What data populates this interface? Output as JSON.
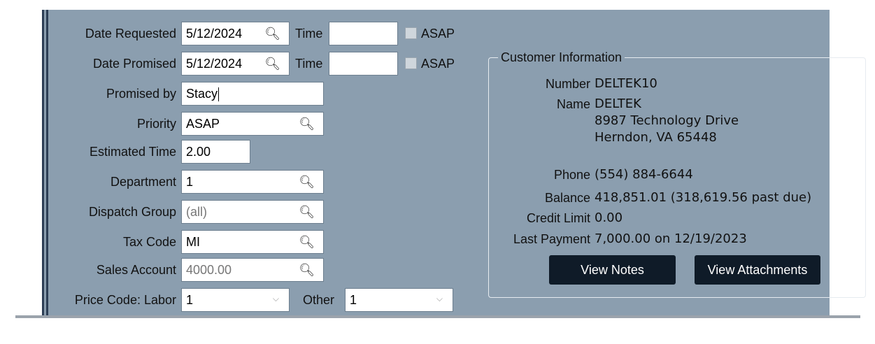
{
  "form": {
    "date_requested": {
      "label": "Date Requested",
      "value": "5/12/2024",
      "time_label": "Time",
      "time_value": "",
      "asap_label": "ASAP"
    },
    "date_promised": {
      "label": "Date Promised",
      "value": "5/12/2024",
      "time_label": "Time",
      "time_value": "",
      "asap_label": "ASAP"
    },
    "promised_by": {
      "label": "Promised by",
      "value": "Stacy"
    },
    "priority": {
      "label": "Priority",
      "value": "ASAP"
    },
    "estimated_time": {
      "label": "Estimated Time",
      "value": "2.00"
    },
    "department": {
      "label": "Department",
      "value": "1"
    },
    "dispatch_group": {
      "label": "Dispatch Group",
      "value": "(all)"
    },
    "tax_code": {
      "label": "Tax Code",
      "value": "MI"
    },
    "sales_account": {
      "label": "Sales Account",
      "value": "4000.00"
    },
    "price_code": {
      "label": "Price Code: Labor",
      "labor_value": "1",
      "other_label": "Other",
      "other_value": "1"
    }
  },
  "customer": {
    "title": "Customer Information",
    "number_label": "Number",
    "number": "DELTEK10",
    "name_label": "Name",
    "name": "DELTEK",
    "address1": "8987 Technology Drive",
    "address2": "Herndon, VA 65448",
    "phone_label": "Phone",
    "phone": "(554) 884-6644",
    "balance_label": "Balance",
    "balance": "418,851.01  (318,619.56 past due)",
    "credit_limit_label": "Credit Limit",
    "credit_limit": "0.00",
    "last_payment_label": "Last Payment",
    "last_payment": "7,000.00 on 12/19/2023",
    "view_notes": "View Notes",
    "view_attachments": "View Attachments"
  },
  "colors": {
    "panel": "#8b9eaf",
    "button": "#0f1b28",
    "border_accent": "#2c3e55"
  }
}
